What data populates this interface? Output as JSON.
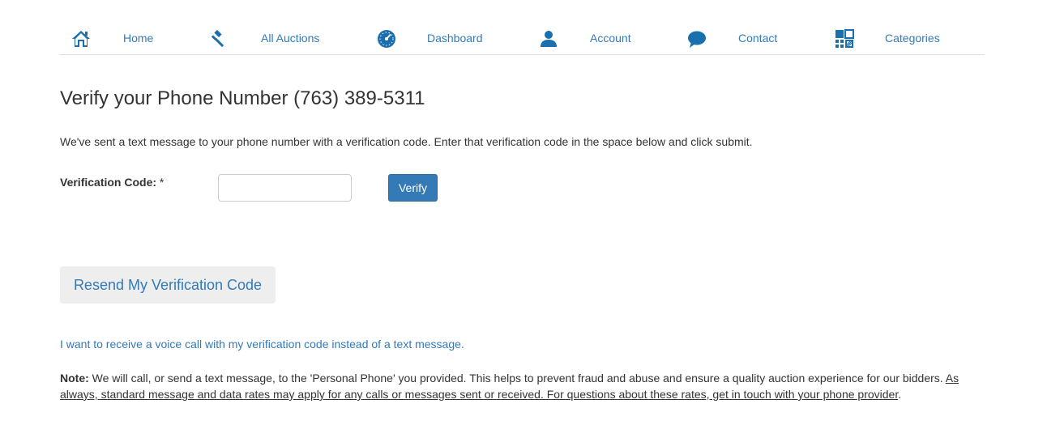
{
  "nav": {
    "items": [
      {
        "label": "Home",
        "icon": "home-icon"
      },
      {
        "label": "All Auctions",
        "icon": "gavel-icon"
      },
      {
        "label": "Dashboard",
        "icon": "dashboard-icon"
      },
      {
        "label": "Account",
        "icon": "user-icon"
      },
      {
        "label": "Contact",
        "icon": "chat-icon"
      },
      {
        "label": "Categories",
        "icon": "categories-icon"
      }
    ],
    "icon_color": "#1a6fae",
    "link_color": "#337ab7"
  },
  "page": {
    "title": "Verify your Phone Number (763) 389-5311",
    "intro": "We've sent a text message to your phone number with a verification code. Enter that verification code in the space below and click submit."
  },
  "form": {
    "code_label": "Verification Code:",
    "required_mark": "*",
    "code_value": "",
    "code_placeholder": "",
    "verify_label": "Verify"
  },
  "resend": {
    "label": "Resend My Verification Code"
  },
  "voice_link": {
    "label": "I want to receive a voice call with my verification code instead of a text message."
  },
  "note": {
    "lead": "Note:",
    "body": " We will call, or send a text message, to the 'Personal Phone' you provided. This helps to prevent fraud and abuse and ensure a quality auction experience for our bidders. ",
    "rates": "As always, standard message and data rates may apply for any calls or messages sent or received. For questions about these rates, get in touch with your phone provider",
    "end": "."
  }
}
